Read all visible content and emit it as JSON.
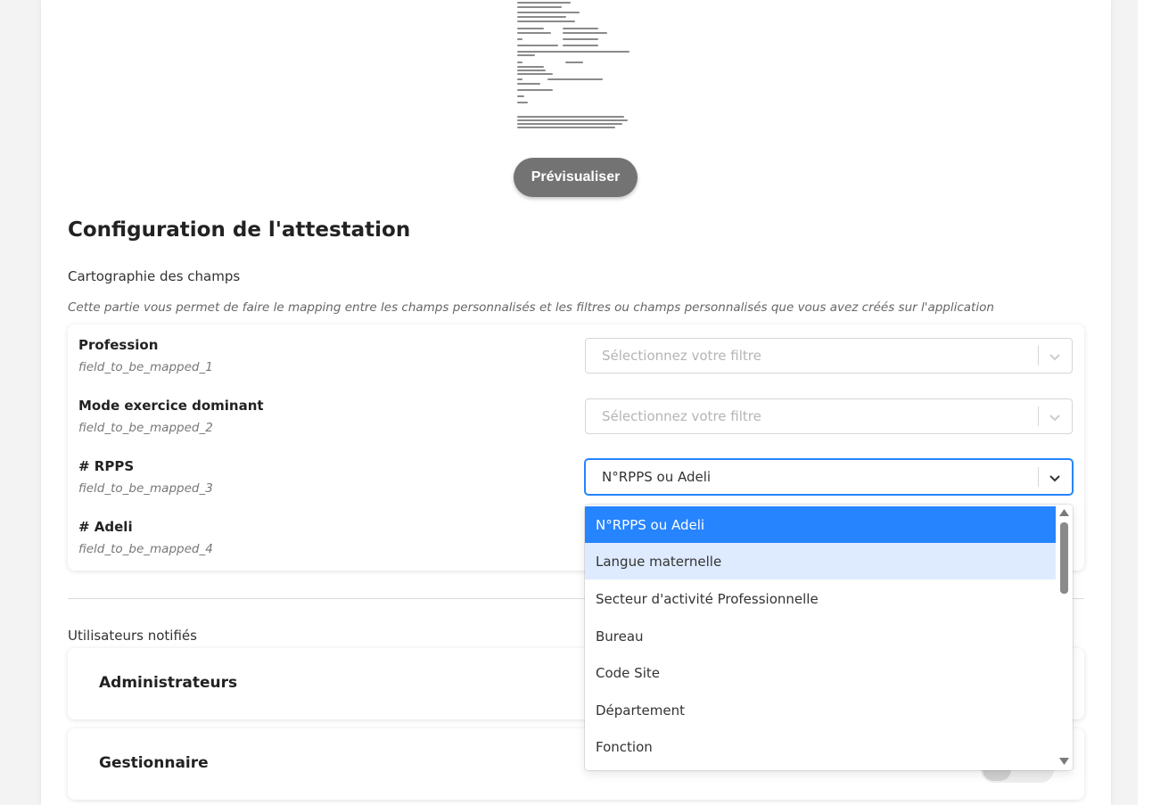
{
  "preview": {
    "button_label": "Prévisualiser"
  },
  "config": {
    "title": "Configuration de l'attestation",
    "subtitle": "Cartographie des champs",
    "description": "Cette partie vous permet de faire le mapping entre les champs personnalisés et les filtres ou champs personnalisés que vous avez créés sur l'application",
    "mappings": [
      {
        "label": "Profession",
        "key": "field_to_be_mapped_1",
        "value": "Sélectionnez votre filtre"
      },
      {
        "label": "Mode exercice dominant",
        "key": "field_to_be_mapped_2",
        "value": "Sélectionnez votre filtre"
      },
      {
        "label": "# RPPS",
        "key": "field_to_be_mapped_3",
        "value": "N°RPPS ou Adeli"
      },
      {
        "label": "# Adeli",
        "key": "field_to_be_mapped_4"
      }
    ]
  },
  "dropdown": {
    "options": [
      "N°RPPS ou Adeli",
      "Langue maternelle",
      "Secteur d'activité Professionnelle",
      "Bureau",
      "Code Site",
      "Département",
      "Fonction"
    ]
  },
  "notified": {
    "label": "Utilisateurs notifiés",
    "groups": [
      "Administrateurs",
      "Gestionnaire"
    ]
  },
  "icons": {
    "select_chevron": "chevron-down-icon",
    "scroll_up": "scroll-up-arrow-icon",
    "scroll_down": "scroll-down-arrow-icon"
  },
  "colors": {
    "accent": "#2684ff",
    "option_hover": "#deebff",
    "preview_button": "#737373"
  }
}
